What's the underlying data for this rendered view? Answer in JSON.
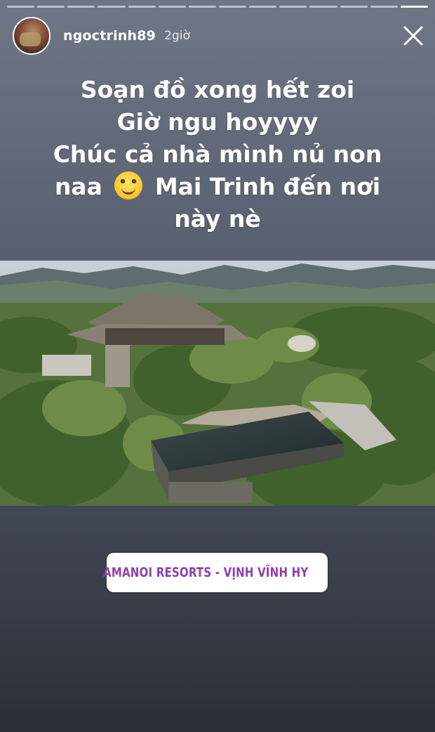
{
  "story": {
    "progress_segments": 14,
    "active_segment": 14,
    "username": "ngoctrinh89",
    "time_ago": "2giờ",
    "close_icon": "close-icon"
  },
  "caption": {
    "line1": "Soạn đồ xong hết zoi",
    "line2": "Giờ ngu hoyyyy",
    "line3": "Chúc cả nhà mình nủ non",
    "line4_before_emoji": "naa",
    "emoji": "smiling-face-emoji",
    "line4_after_emoji": "Mai Trinh đến nơi",
    "line5": "này nè"
  },
  "photo": {
    "subject": "resort-aerial-photo"
  },
  "location_sticker": {
    "text": "AMANOI RESORTS - VỊNH VĨNH HY",
    "icon": "location-pin-icon",
    "color": "#8d3fb0"
  }
}
